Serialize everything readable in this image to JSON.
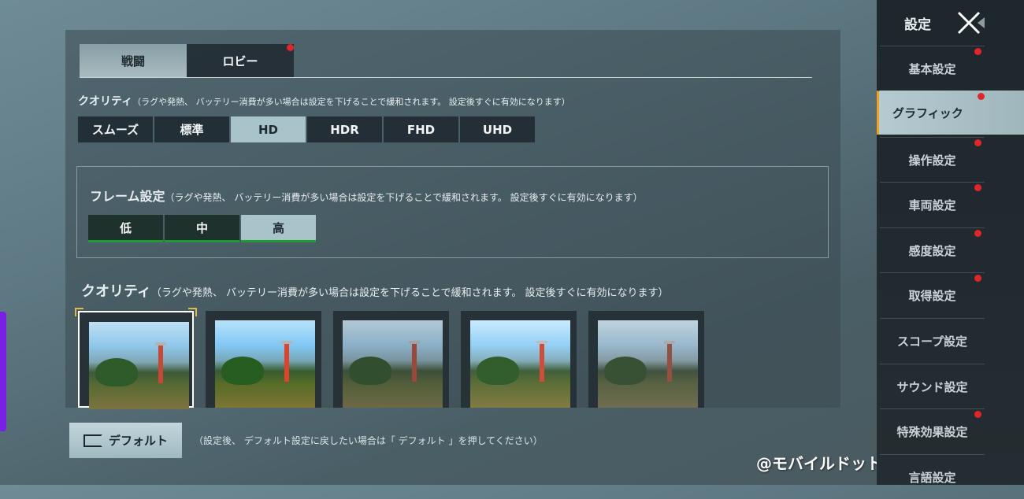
{
  "tabs": [
    {
      "label": "戦闘",
      "active": true,
      "badge": false
    },
    {
      "label": "ロビー",
      "active": false,
      "badge": true
    }
  ],
  "quality_section": {
    "title": "クオリティ",
    "note": "（ラグや発熱、 バッテリー消費が多い場合は設定を下げることで緩和されます。 設定後すぐに有効になります）",
    "options": [
      "スムーズ",
      "標準",
      "HD",
      "HDR",
      "FHD",
      "UHD"
    ],
    "selected": "HD"
  },
  "frame_section": {
    "title": "フレーム設定",
    "note": "（ラグや発熱、 バッテリー消費が多い場合は設定を下げることで緩和されます。 設定後すぐに有効になります）",
    "options": [
      "低",
      "中",
      "高"
    ],
    "selected": "高"
  },
  "style_section": {
    "title": "クオリティ",
    "note": "（ラグや発熱、 バッテリー消費が多い場合は設定を下げることで緩和されます。 設定後すぐに有効になります）",
    "thumbnail_count": 5,
    "selected_index": 0
  },
  "footer": {
    "default_button": "デフォルト",
    "hint": "（設定後、 デフォルト設定に戻したい場合は「 デフォルト 」を押してください）"
  },
  "watermark": "@モバイルドットコム",
  "sidebar": {
    "title": "設定",
    "items": [
      {
        "label": "基本設定",
        "badge": true,
        "active": false
      },
      {
        "label": "グラフィック",
        "badge": true,
        "active": true
      },
      {
        "label": "操作設定",
        "badge": true,
        "active": false
      },
      {
        "label": "車両設定",
        "badge": true,
        "active": false
      },
      {
        "label": "感度設定",
        "badge": true,
        "active": false
      },
      {
        "label": "取得設定",
        "badge": true,
        "active": false
      },
      {
        "label": "スコープ設定",
        "badge": false,
        "active": false
      },
      {
        "label": "サウンド設定",
        "badge": false,
        "active": false
      },
      {
        "label": "特殊効果設定",
        "badge": true,
        "active": false
      },
      {
        "label": "言語設定",
        "badge": false,
        "active": false
      }
    ]
  },
  "colors": {
    "badge": "#e0262a",
    "accent": "#f0a21f",
    "selected_option": "#a9c3ca",
    "fps_underline": "#1f9a35"
  }
}
